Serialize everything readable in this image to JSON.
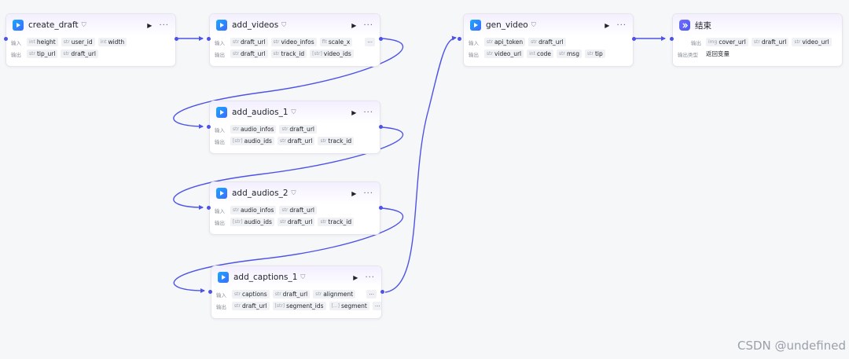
{
  "nodes": {
    "create_draft": {
      "title": "create_draft",
      "input_label": "输入",
      "output_label": "输出",
      "inputs": [
        {
          "type": "int",
          "name": "height"
        },
        {
          "type": "str",
          "name": "user_id"
        },
        {
          "type": "int",
          "name": "width"
        }
      ],
      "outputs": [
        {
          "type": "str",
          "name": "tip_url"
        },
        {
          "type": "str",
          "name": "draft_url"
        }
      ]
    },
    "add_videos": {
      "title": "add_videos",
      "input_label": "输入",
      "output_label": "输出",
      "inputs": [
        {
          "type": "str",
          "name": "draft_url"
        },
        {
          "type": "str",
          "name": "video_infos"
        },
        {
          "type": "flt",
          "name": "scale_x"
        }
      ],
      "outputs": [
        {
          "type": "str",
          "name": "draft_url"
        },
        {
          "type": "str",
          "name": "track_id"
        },
        {
          "type": "[str]",
          "name": "video_ids"
        }
      ]
    },
    "add_audios_1": {
      "title": "add_audios_1",
      "input_label": "输入",
      "output_label": "输出",
      "inputs": [
        {
          "type": "str",
          "name": "audio_infos"
        },
        {
          "type": "str",
          "name": "draft_url"
        }
      ],
      "outputs": [
        {
          "type": "[str]",
          "name": "audio_ids"
        },
        {
          "type": "str",
          "name": "draft_url"
        },
        {
          "type": "str",
          "name": "track_id"
        }
      ]
    },
    "add_audios_2": {
      "title": "add_audios_2",
      "input_label": "输入",
      "output_label": "输出",
      "inputs": [
        {
          "type": "str",
          "name": "audio_infos"
        },
        {
          "type": "str",
          "name": "draft_url"
        }
      ],
      "outputs": [
        {
          "type": "[str]",
          "name": "audio_ids"
        },
        {
          "type": "str",
          "name": "draft_url"
        },
        {
          "type": "str",
          "name": "track_id"
        }
      ]
    },
    "add_captions_1": {
      "title": "add_captions_1",
      "input_label": "输入",
      "output_label": "输出",
      "inputs": [
        {
          "type": "str",
          "name": "captions"
        },
        {
          "type": "str",
          "name": "draft_url"
        },
        {
          "type": "str",
          "name": "alignment"
        }
      ],
      "outputs": [
        {
          "type": "str",
          "name": "draft_url"
        },
        {
          "type": "[str]",
          "name": "segment_ids"
        },
        {
          "type": "[...]",
          "name": "segment"
        }
      ]
    },
    "gen_video": {
      "title": "gen_video",
      "input_label": "输入",
      "output_label": "输出",
      "inputs": [
        {
          "type": "str",
          "name": "api_token"
        },
        {
          "type": "str",
          "name": "draft_url"
        }
      ],
      "outputs": [
        {
          "type": "str",
          "name": "video_url"
        },
        {
          "type": "int",
          "name": "code"
        },
        {
          "type": "str",
          "name": "msg"
        },
        {
          "type": "str",
          "name": "tip"
        }
      ]
    },
    "end": {
      "title": "结束",
      "output_label": "输出",
      "output_type_label": "输出类型",
      "outputs": [
        {
          "type": "img",
          "name": "cover_url"
        },
        {
          "type": "str",
          "name": "draft_url"
        },
        {
          "type": "str",
          "name": "video_url"
        }
      ],
      "output_type_value": "返回变量"
    }
  },
  "more_glyph": "···",
  "run_glyph": "▶",
  "watermark": "CSDN @undefined",
  "colors": {
    "edge": "#4d53e8",
    "icon_gradient_start": "#1aa8ff",
    "icon_gradient_end": "#3a6bff",
    "end_icon": "#5b5ff2"
  }
}
